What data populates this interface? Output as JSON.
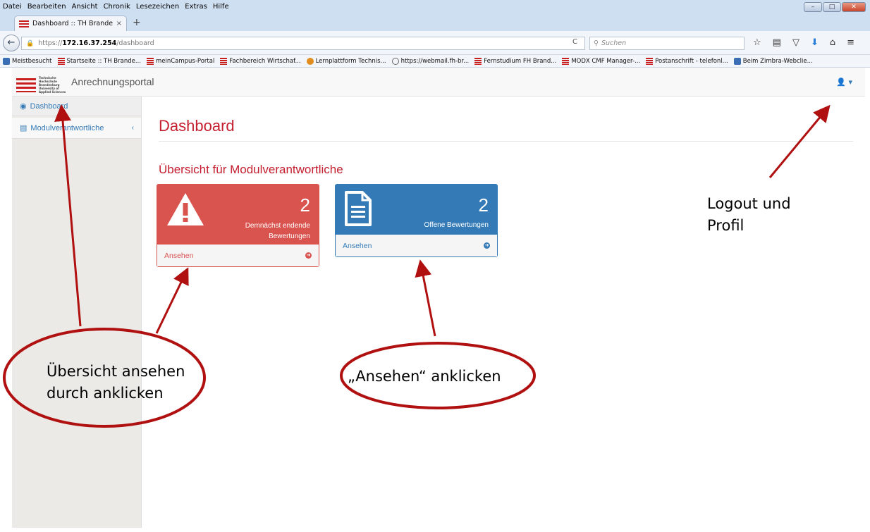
{
  "menubar": {
    "items": [
      "Datei",
      "Bearbeiten",
      "Ansicht",
      "Chronik",
      "Lesezeichen",
      "Extras",
      "Hilfe"
    ],
    "min": "–",
    "max": "□",
    "close": "✕"
  },
  "tab": {
    "title": "Dashboard :: TH Brandenb...",
    "close": "×",
    "new": "+"
  },
  "address": {
    "prefix": "https://",
    "host": "172.16.37.254",
    "path": "/dashboard"
  },
  "search": {
    "placeholder": "Suchen"
  },
  "bookmarks": [
    "Meistbesucht",
    "Startseite :: TH Brande...",
    "meinCampus-Portal",
    "Fachbereich Wirtschaf...",
    "Lernplattform Technis...",
    "https://webmail.fh-br...",
    "Fernstudium FH Brand...",
    "MODX CMF Manager-...",
    "Postanschrift - telefonl...",
    "Beim Zimbra-Webclie..."
  ],
  "brand": {
    "logo_text": "Technische Hochschule Brandenburg University of Applied Sciences",
    "name": "Anrechnungsportal"
  },
  "sidebar": {
    "items": [
      {
        "label": "Dashboard",
        "icon": "dashboard-icon"
      },
      {
        "label": "Modulverantwortliche",
        "icon": "document-icon",
        "chevron": "‹"
      }
    ]
  },
  "main": {
    "title": "Dashboard",
    "section_title": "Übersicht für Modulverantwortliche",
    "panels": [
      {
        "count": "2",
        "text": "Demnächst endende Bewertungen",
        "link": "Ansehen",
        "color": "#d9534f",
        "icon": "warning-icon"
      },
      {
        "count": "2",
        "text": "Offene Bewertungen",
        "link": "Ansehen",
        "color": "#337ab7",
        "icon": "file-text-icon"
      }
    ]
  },
  "annotations": {
    "logout_line1": "Logout und",
    "logout_line2": "Profil",
    "left_line1": "Übersicht ansehen",
    "left_line2": "durch anklicken",
    "mid": "„Ansehen“ anklicken",
    "color": "#b01010"
  }
}
